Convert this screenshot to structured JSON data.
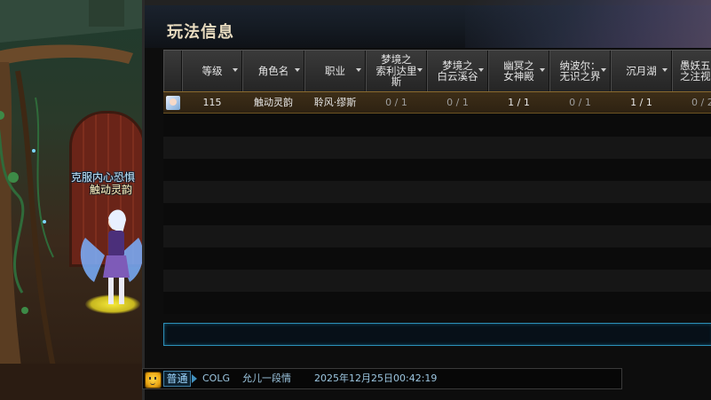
{
  "panel": {
    "title": "玩法信息"
  },
  "table": {
    "columns": [
      {
        "label": "",
        "sortable": false
      },
      {
        "label": "等级",
        "sortable": true
      },
      {
        "label": "角色名",
        "sortable": true
      },
      {
        "label": "职业",
        "sortable": true
      },
      {
        "label": "梦境之\n索利达里\n斯",
        "sortable": true
      },
      {
        "label": "梦境之\n白云溪谷",
        "sortable": true
      },
      {
        "label": "幽冥之\n女神殿",
        "sortable": true
      },
      {
        "label": "纳波尔：\n无识之界",
        "sortable": true
      },
      {
        "label": "沉月湖",
        "sortable": true
      },
      {
        "label": "愚妖五\n之注视",
        "sortable": false
      }
    ],
    "rows": [
      {
        "level": "115",
        "name": "触动灵韵",
        "class": "聆风·缪斯",
        "c1": "0 / 1",
        "c2": "0 / 1",
        "c3": "1 / 1",
        "c4": "0 / 1",
        "c5": "1 / 1",
        "c6": "0 / 2"
      }
    ]
  },
  "scene": {
    "guild_text": "克服内心恐惧",
    "char_name": "触动灵韵"
  },
  "chat": {
    "channel": "普通",
    "source": "COLG",
    "sender": "允儿一段情",
    "timestamp": "2025年12月25日00:42:19"
  },
  "colors": {
    "input_border": "#2d8fb8",
    "highlight_row": "#3d2e18",
    "title": "#e9dcc0"
  }
}
